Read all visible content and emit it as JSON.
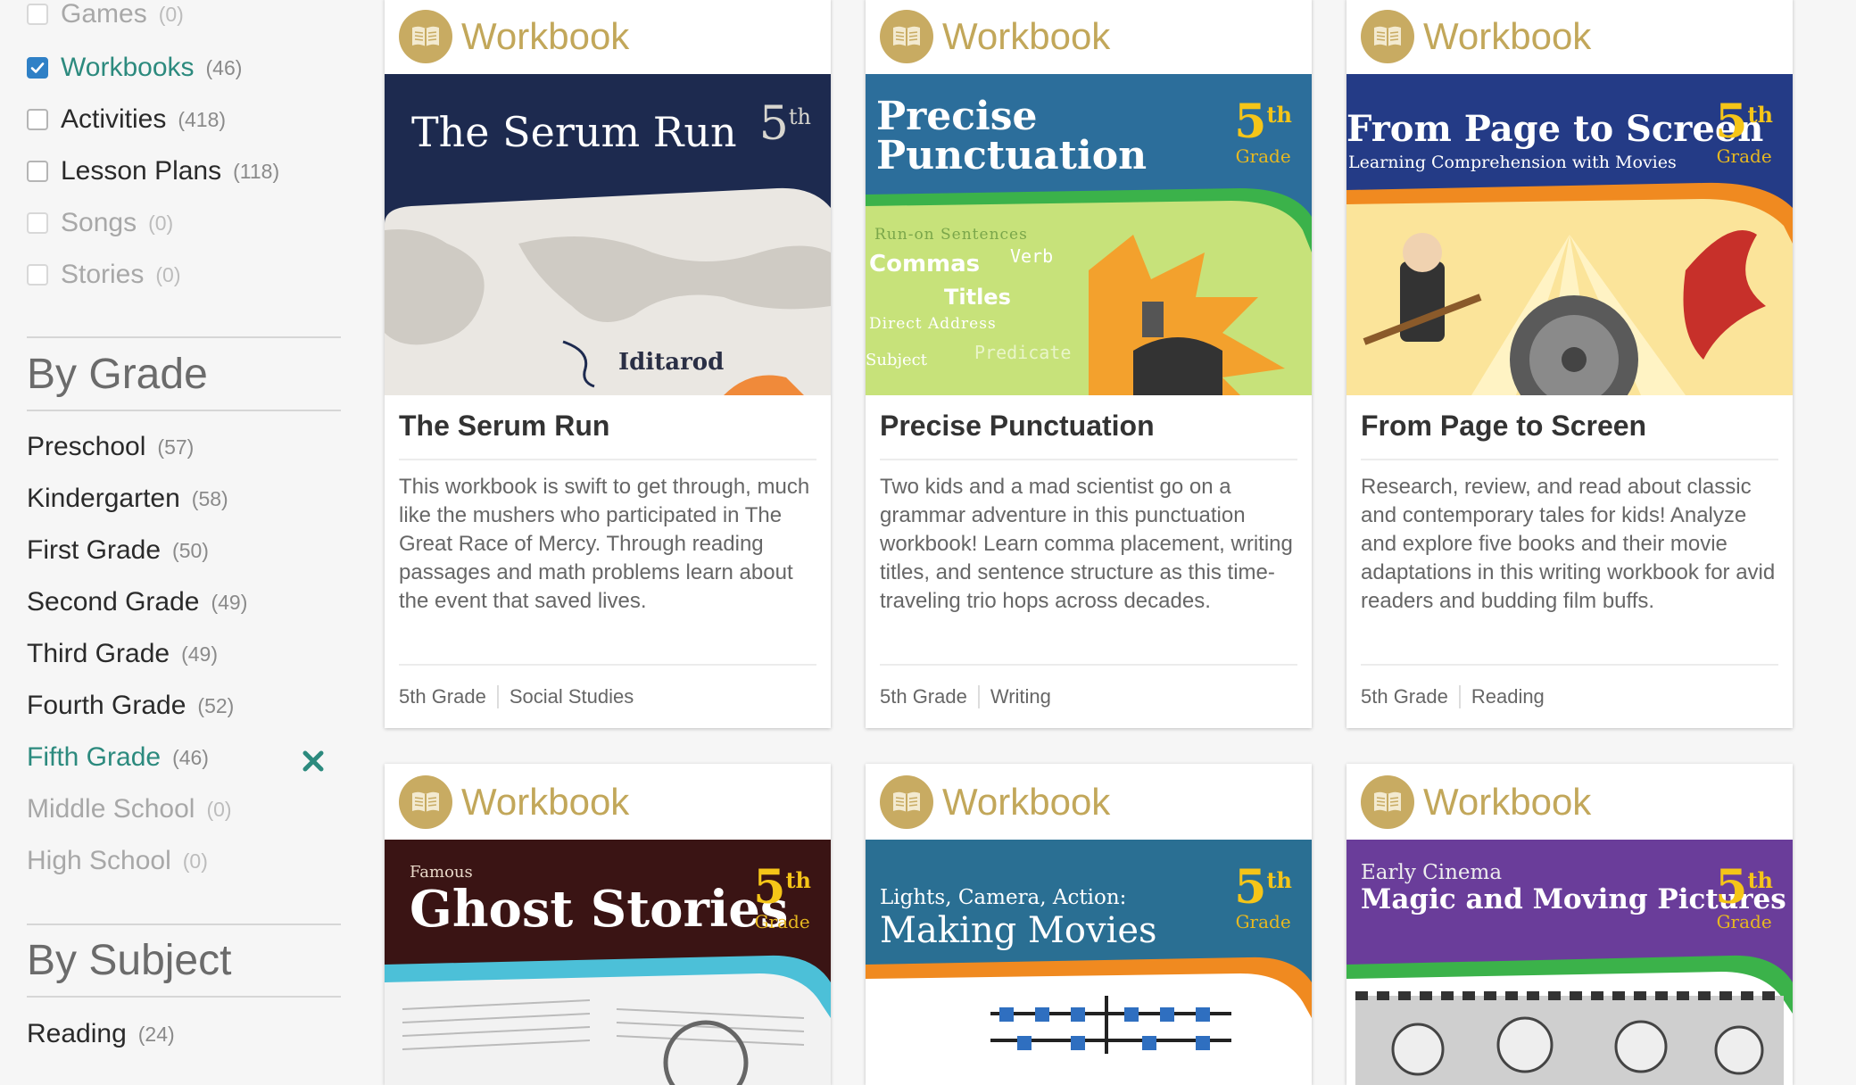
{
  "sidebar": {
    "type_filters": [
      {
        "label": "Games",
        "count": "(0)",
        "checked": false,
        "disabled": true
      },
      {
        "label": "Workbooks",
        "count": "(46)",
        "checked": true,
        "disabled": false
      },
      {
        "label": "Activities",
        "count": "(418)",
        "checked": false,
        "disabled": false
      },
      {
        "label": "Lesson Plans",
        "count": "(118)",
        "checked": false,
        "disabled": false
      },
      {
        "label": "Songs",
        "count": "(0)",
        "checked": false,
        "disabled": true
      },
      {
        "label": "Stories",
        "count": "(0)",
        "checked": false,
        "disabled": true
      }
    ],
    "by_grade": {
      "title": "By Grade",
      "items": [
        {
          "label": "Preschool",
          "count": "(57)"
        },
        {
          "label": "Kindergarten",
          "count": "(58)"
        },
        {
          "label": "First Grade",
          "count": "(50)"
        },
        {
          "label": "Second Grade",
          "count": "(49)"
        },
        {
          "label": "Third Grade",
          "count": "(49)"
        },
        {
          "label": "Fourth Grade",
          "count": "(52)"
        },
        {
          "label": "Fifth Grade",
          "count": "(46)",
          "active": true
        },
        {
          "label": "Middle School",
          "count": "(0)",
          "disabled": true
        },
        {
          "label": "High School",
          "count": "(0)",
          "disabled": true
        }
      ],
      "clear_icon": "close-icon"
    },
    "by_subject": {
      "title": "By Subject",
      "items": [
        {
          "label": "Reading",
          "count": "(24)"
        }
      ]
    }
  },
  "cards": [
    {
      "type_label": "Workbook",
      "cover_title_line1": "The Serum Run",
      "cover_title_line2": "",
      "cover_caption": "Iditarod",
      "grade_num": "5",
      "grade_sup": "th",
      "grade_word": "",
      "title": "The Serum Run",
      "description": "This workbook is swift to get through, much like the mushers who participated in The Great Race of Mercy. Through reading passages and math problems learn about the event that saved lives.",
      "tags": [
        "5th Grade",
        "Social Studies"
      ]
    },
    {
      "type_label": "Workbook",
      "cover_title_line1": "Precise",
      "cover_title_line2": "Punctuation",
      "cover_words": [
        "Run-on Sentences",
        "Commas",
        "Verb",
        "Titles",
        "Direct Address",
        "Subject",
        "Predicate"
      ],
      "grade_num": "5",
      "grade_sup": "th",
      "grade_word": "Grade",
      "title": "Precise Punctuation",
      "description": "Two kids and a mad scientist go on a grammar adventure in this punctuation workbook! Learn comma placement, writing titles, and sentence structure as this time-traveling trio hops across decades.",
      "tags": [
        "5th Grade",
        "Writing"
      ]
    },
    {
      "type_label": "Workbook",
      "cover_title_line1": "From Page to Screen",
      "cover_subtitle": "Learning Comprehension with Movies",
      "grade_num": "5",
      "grade_sup": "th",
      "grade_word": "Grade",
      "title": "From Page to Screen",
      "description": "Research, review, and read about classic and contemporary tales for kids! Analyze and explore five books and their movie adaptations in this writing workbook for avid readers and budding film buffs.",
      "tags": [
        "5th Grade",
        "Reading"
      ]
    },
    {
      "type_label": "Workbook",
      "cover_kicker": "Famous",
      "cover_title_line1": "Ghost Stories",
      "grade_num": "5",
      "grade_sup": "th",
      "grade_word": "Grade"
    },
    {
      "type_label": "Workbook",
      "cover_kicker": "Lights, Camera, Action:",
      "cover_title_line1": "Making Movies",
      "grade_num": "5",
      "grade_sup": "th",
      "grade_word": "Grade"
    },
    {
      "type_label": "Workbook",
      "cover_kicker": "Early Cinema",
      "cover_title_line1": "Magic and Moving Pictures",
      "grade_num": "5",
      "grade_sup": "th",
      "grade_word": "Grade"
    }
  ],
  "colors": {
    "accent_teal": "#2c8a7e",
    "checkbox_blue": "#2f80c6",
    "workbook_gold": "#c2a75a"
  }
}
